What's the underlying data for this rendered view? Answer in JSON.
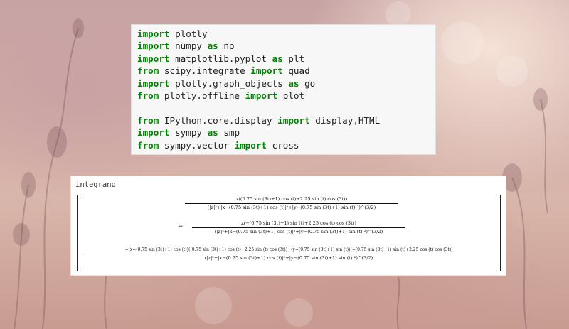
{
  "code_cell": {
    "lines": [
      [
        {
          "kw": "import"
        },
        {
          "t": " plotly"
        }
      ],
      [
        {
          "kw": "import"
        },
        {
          "t": " numpy "
        },
        {
          "kw": "as"
        },
        {
          "t": " np"
        }
      ],
      [
        {
          "kw": "import"
        },
        {
          "t": " matplotlib.pyplot "
        },
        {
          "kw": "as"
        },
        {
          "t": " plt"
        }
      ],
      [
        {
          "kw": "from"
        },
        {
          "t": " scipy.integrate "
        },
        {
          "kw": "import"
        },
        {
          "t": " quad"
        }
      ],
      [
        {
          "kw": "import"
        },
        {
          "t": " plotly.graph_objects "
        },
        {
          "kw": "as"
        },
        {
          "t": " go"
        }
      ],
      [
        {
          "kw": "from"
        },
        {
          "t": " plotly.offline "
        },
        {
          "kw": "import"
        },
        {
          "t": " plot"
        }
      ],
      [],
      [
        {
          "kw": "from"
        },
        {
          "t": " IPython.core.display "
        },
        {
          "kw": "import"
        },
        {
          "t": " display,HTML"
        }
      ],
      [
        {
          "kw": "import"
        },
        {
          "t": " sympy "
        },
        {
          "kw": "as"
        },
        {
          "t": " smp"
        }
      ],
      [
        {
          "kw": "from"
        },
        {
          "t": " sympy.vector "
        },
        {
          "kw": "import"
        },
        {
          "t": " cross"
        }
      ]
    ]
  },
  "output": {
    "label": "integrand",
    "rows": [
      {
        "negative": false,
        "numerator": "z((0.75 sin (3t)+1) cos (t)+2.25 sin (t) cos (3t))",
        "denominator": "(|z|²+|x−(0.75 sin (3t)+1) cos (t)|²+|y−(0.75 sin (3t)+1) sin (t)|²)^(3/2)"
      },
      {
        "negative": true,
        "numerator": "z(−(0.75 sin (3t)+1) sin (t)+2.25 cos (t) cos (3t))",
        "denominator": "(|z|²+|x−(0.75 sin (3t)+1) cos (t)|²+|y−(0.75 sin (3t)+1) sin (t)|²)^(3/2)"
      },
      {
        "negative": false,
        "numerator": "−(x−(0.75 sin (3t)+1) cos (t))((0.75 sin (3t)+1) cos (t)+2.25 sin (t) cos (3t))+(y−(0.75 sin (3t)+1) sin (t))(−(0.75 sin (3t)+1) sin (t)+2.25 cos (t) cos (3t))",
        "denominator": "(|z|²+|x−(0.75 sin (3t)+1) cos (t)|²+|y−(0.75 sin (3t)+1) sin (t)|²)^(3/2)"
      }
    ]
  }
}
